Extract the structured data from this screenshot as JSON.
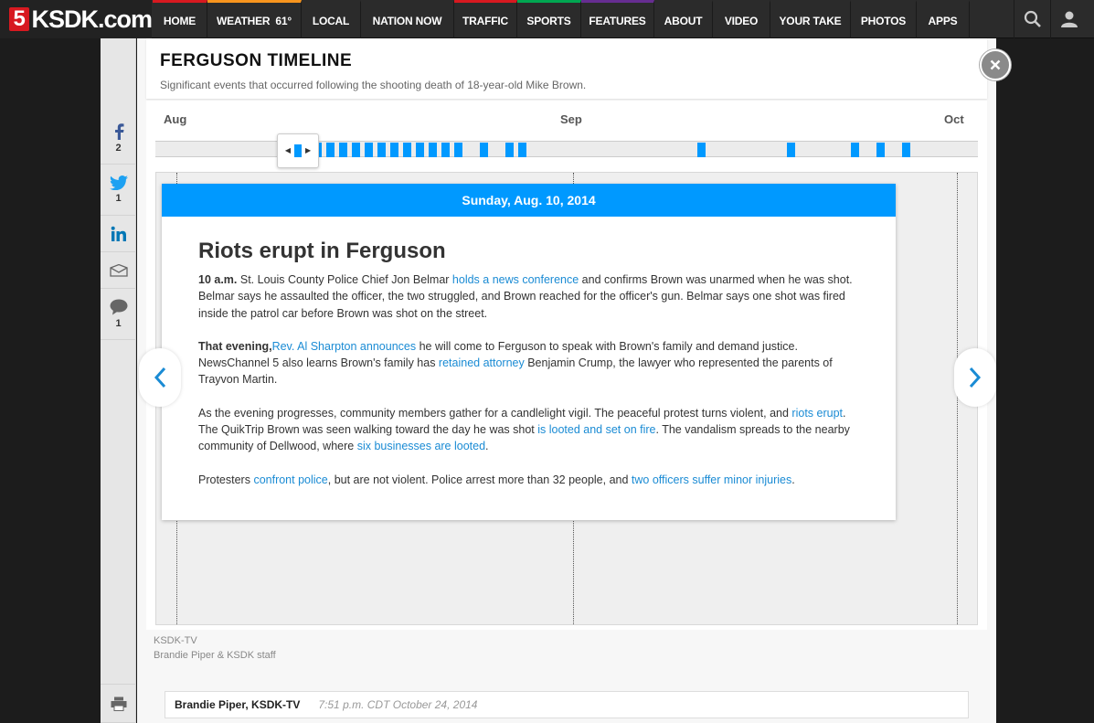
{
  "site": {
    "logo_number": "5",
    "logo_text": "KSDK.com"
  },
  "nav": {
    "items": [
      {
        "label": "Home",
        "accent": "#d71920",
        "width": 60
      },
      {
        "label": "Weather",
        "temp": "61°",
        "accent": "#f7941d",
        "width": 103
      },
      {
        "label": "Local",
        "accent": "",
        "width": 65
      },
      {
        "label": "Nation Now",
        "accent": "",
        "width": 102
      },
      {
        "label": "Traffic",
        "accent": "#d71920",
        "width": 69
      },
      {
        "label": "Sports",
        "accent": "#00a651",
        "width": 70
      },
      {
        "label": "Features",
        "accent": "#662d91",
        "width": 80
      },
      {
        "label": "About",
        "accent": "",
        "width": 64
      },
      {
        "label": "Video",
        "accent": "",
        "width": 63
      },
      {
        "label": "Your Take",
        "accent": "",
        "width": 88
      },
      {
        "label": "Photos",
        "accent": "",
        "width": 72
      },
      {
        "label": "Apps",
        "accent": "",
        "width": 58
      }
    ],
    "icons": [
      "search-icon",
      "user-icon"
    ]
  },
  "share": {
    "facebook_count": "2",
    "twitter_count": "1",
    "comments_count": "1"
  },
  "timeline": {
    "title": "FERGUSON TIMELINE",
    "subtitle": "Significant events that occurred following the shooting death of 18-year-old Mike Brown.",
    "months": [
      {
        "label": "Aug",
        "day": 0
      },
      {
        "label": "Sep",
        "day": 31
      },
      {
        "label": "Oct",
        "day": 61
      }
    ],
    "event_days": [
      10,
      11,
      12,
      13,
      14,
      15,
      16,
      17,
      18,
      19,
      20,
      21,
      22,
      24,
      26,
      27,
      41,
      48,
      53,
      55,
      57
    ],
    "selected_day": 10
  },
  "event": {
    "date": "Sunday, Aug. 10, 2014",
    "headline": "Riots erupt in Ferguson",
    "p1": {
      "lead": "10 a.m.",
      "t1": " St. Louis County Police Chief Jon Belmar ",
      "link1": "holds a news conference",
      "t2": " and confirms Brown was unarmed when he was shot. Belmar says he assaulted the officer, the two struggled, and Brown reached for the officer's gun. Belmar says one shot was fired inside the patrol car before Brown was shot on the street."
    },
    "p2": {
      "lead": "That evening,",
      "link1": "Rev. Al Sharpton announces",
      "t1": " he will come to Ferguson to speak with Brown's family and demand justice. NewsChannel 5 also learns Brown's family has ",
      "link2": "retained attorney",
      "t2": " Benjamin Crump, the lawyer who represented the parents of Trayvon Martin."
    },
    "p3": {
      "t1": "As the evening progresses, community members gather for a candlelight vigil. The peaceful protest turns violent, and ",
      "link1": "riots erupt",
      "t2": ". The QuikTrip Brown was seen walking toward the day he was shot ",
      "link2": "is looted and set on fire",
      "t3": ". The vandalism spreads to the nearby community of Dellwood, where ",
      "link3": "six businesses are looted",
      "t4": "."
    },
    "p4": {
      "t1": "Protesters ",
      "link1": "confront police",
      "t2": ", but are not violent. Police arrest more than 32 people, and ",
      "link2": "two officers suffer minor injuries",
      "t3": "."
    }
  },
  "credits": {
    "source": "KSDK-TV",
    "staff": "Brandie Piper & KSDK staff"
  },
  "byline": {
    "author": "Brandie Piper, KSDK-TV",
    "time": "7:51 p.m. CDT October 24, 2014"
  },
  "colors": {
    "accent": "#0099ff",
    "link": "#1a8bd4",
    "nav_bg": "#2b2b2b"
  }
}
